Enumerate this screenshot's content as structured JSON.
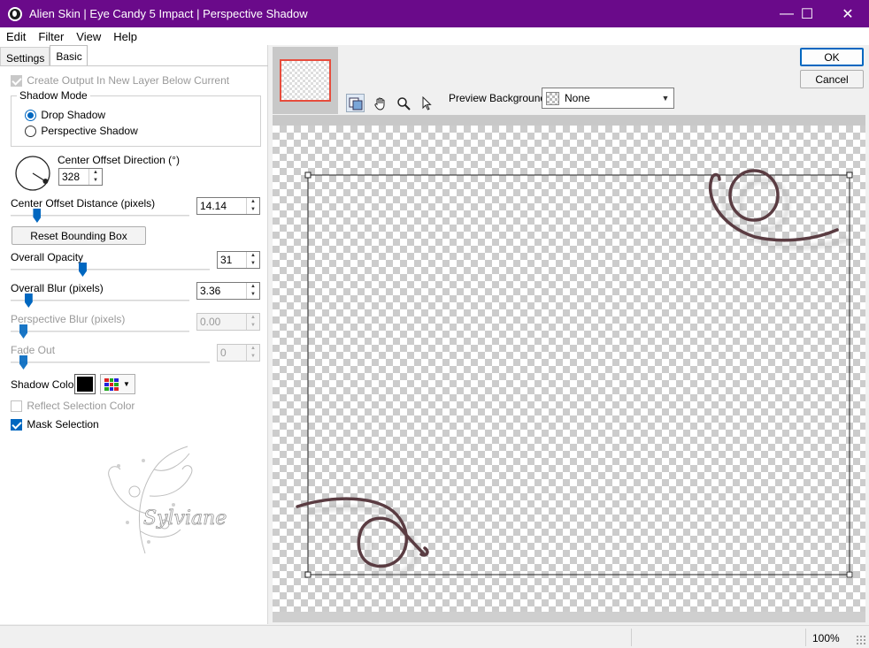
{
  "window": {
    "title": "Alien Skin | Eye Candy 5 Impact | Perspective Shadow",
    "controls": {
      "minimize": "—",
      "maximize": "☐",
      "close": "✕"
    }
  },
  "menu": {
    "items": [
      "Edit",
      "Filter",
      "View",
      "Help"
    ]
  },
  "tabs": [
    {
      "label": "Settings",
      "active": false
    },
    {
      "label": "Basic",
      "active": true
    }
  ],
  "basic": {
    "create_output": {
      "label": "Create Output In New Layer Below Current",
      "checked": true,
      "enabled": false
    },
    "shadow_mode": {
      "title": "Shadow Mode",
      "options": [
        {
          "label": "Drop Shadow",
          "selected": true
        },
        {
          "label": "Perspective Shadow",
          "selected": false
        }
      ]
    },
    "center_offset_direction": {
      "label": "Center Offset Direction (°)",
      "value": "328"
    },
    "center_offset_distance": {
      "label": "Center Offset Distance (pixels)",
      "value": "14.14",
      "fraction": 0.08
    },
    "reset_button": "Reset Bounding Box",
    "overall_opacity": {
      "label": "Overall Opacity",
      "value": "31",
      "fraction": 0.31
    },
    "overall_blur": {
      "label": "Overall Blur (pixels)",
      "value": "3.36",
      "fraction": 0.03
    },
    "perspective_blur": {
      "label": "Perspective Blur (pixels)",
      "value": "0.00",
      "fraction": 0.0,
      "enabled": false
    },
    "fade_out": {
      "label": "Fade Out",
      "value": "0",
      "fraction": 0.0,
      "enabled": false
    },
    "shadow_color": {
      "label": "Shadow Color",
      "color": "#000000"
    },
    "reflect_selection_color": {
      "label": "Reflect Selection Color",
      "checked": false,
      "enabled": false
    },
    "mask_selection": {
      "label": "Mask Selection",
      "checked": true
    }
  },
  "watermark_text": "Sylviane",
  "dialog_buttons": {
    "ok": "OK",
    "cancel": "Cancel"
  },
  "preview": {
    "background_label": "Preview Background:",
    "background_value": "None",
    "tools": [
      "preview-toggle-icon",
      "hand-icon",
      "zoom-icon",
      "pointer-icon"
    ]
  },
  "status": {
    "zoom": "100%"
  },
  "colors": {
    "title_bar": "#6a0a8a",
    "accent": "#0067c0",
    "swirl": "#5a3c42"
  }
}
